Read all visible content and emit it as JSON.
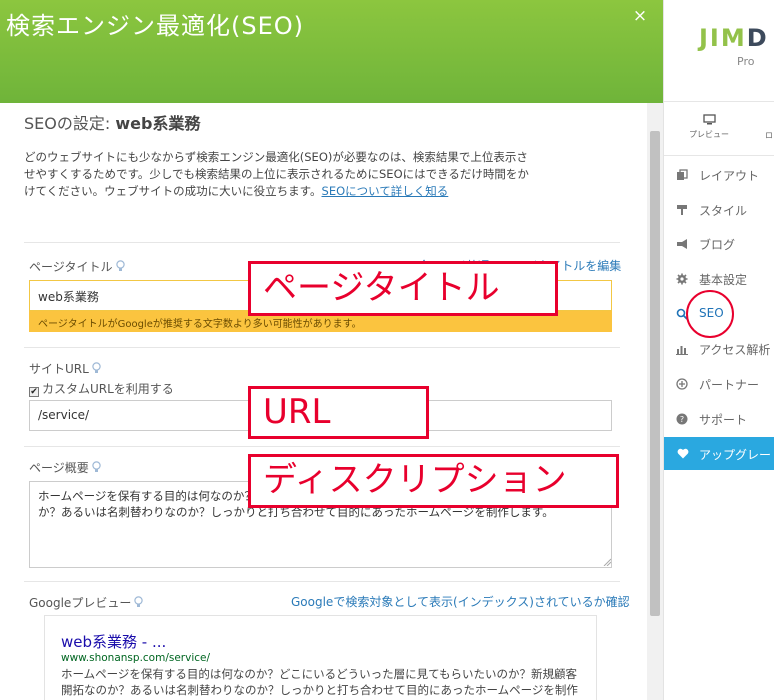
{
  "panel": {
    "title": "検索エンジン最適化(SEO)",
    "close_label": "×"
  },
  "seo": {
    "heading_prefix": "SEOの設定: ",
    "heading_page": "web系業務",
    "intro_text": "どのウェブサイトにも少なからず検索エンジン最適化(SEO)が必要なのは、検索結果で上位表示させやすくするためです。少しでも検索結果の上位に表示されるためにSEOにはできるだけ時間をかけてください。ウェブサイトの成功に大いに役立ちます。",
    "intro_link": "SEOについて詳しく知る"
  },
  "page_title_field": {
    "label": "ページタイトル",
    "edit_link": "全ページ共通のページタイトルを編集",
    "value": "web系業務",
    "warning": "ページタイトルがGoogleが推奨する文字数より多い可能性があります。"
  },
  "url_field": {
    "label": "サイトURL",
    "checkbox_label": "カスタムURLを利用する",
    "checked": true,
    "value": "/service/"
  },
  "description_field": {
    "label": "ページ概要",
    "value": "ホームページを保有する目的は何なのか？どこにいるどういった層に見てもらいたいのか？新規顧客開拓なのか？あるいは名刺替わりなのか？しっかりと打ち合わせて目的にあったホームページを制作します。"
  },
  "google_preview": {
    "label": "Googleプレビュー",
    "index_link": "Googleで検索対象として表示(インデックス)されているか確認",
    "result_title": "web系業務 - ...",
    "result_url": "www.shonansp.com/service/",
    "result_desc": "ホームページを保有する目的は何なのか？どこにいるどういった層に見てもらいたいのか？新規顧客開拓なのか？あるいは名刺替わりなのか？しっかりと打ち合わせて目的にあったホームページを制作します。"
  },
  "annotations": {
    "title": "ページタイトル",
    "url": "URL",
    "description": "ディスクリプション"
  },
  "sidebar": {
    "logo_green": "JIM",
    "logo_dark": "D",
    "plan": "Pro",
    "preview_label": "プレビュー",
    "nav_tail": "ロ",
    "items": [
      {
        "label": "レイアウト",
        "icon": "layout-icon"
      },
      {
        "label": "スタイル",
        "icon": "style-icon"
      },
      {
        "label": "ブログ",
        "icon": "blog-icon"
      },
      {
        "label": "基本設定",
        "icon": "gear-icon"
      },
      {
        "label": "SEO",
        "icon": "search-icon"
      },
      {
        "label": "アクセス解析",
        "icon": "analytics-icon"
      },
      {
        "label": "パートナー",
        "icon": "partner-icon"
      },
      {
        "label": "サポート",
        "icon": "help-icon"
      }
    ],
    "upgrade_label": "アップグレード"
  },
  "colors": {
    "header_green": "#7cbd3d",
    "accent_red": "#e8002d",
    "link_blue": "#2a7ab8",
    "upgrade_blue": "#2aa8e0",
    "warning_yellow": "#fbc43f"
  }
}
